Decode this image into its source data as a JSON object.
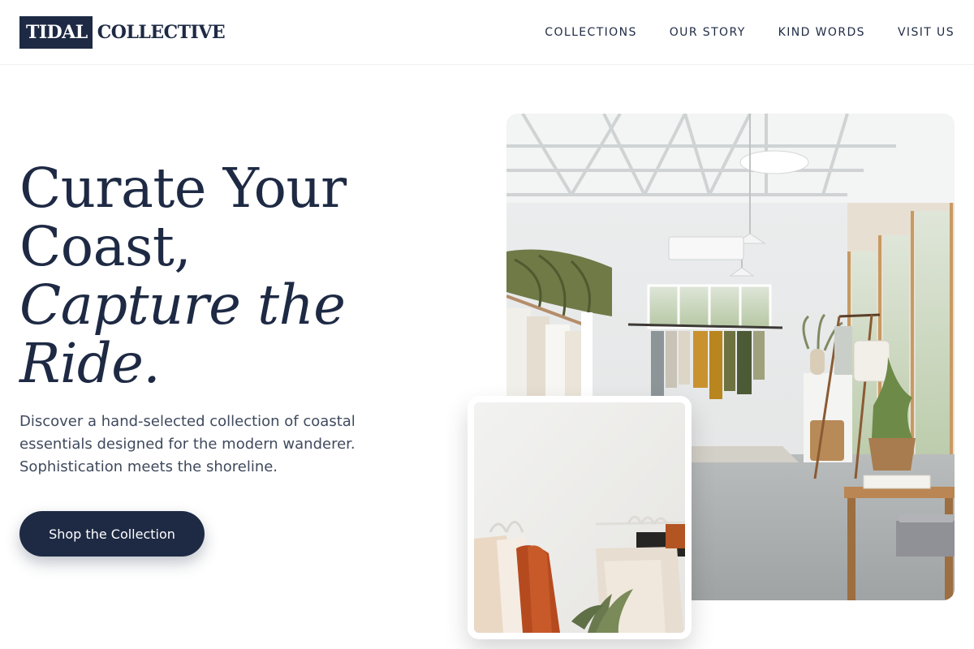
{
  "brand": {
    "box_text": "TIDAL",
    "text": "COLLECTIVE",
    "color": "#1e2a44"
  },
  "nav": {
    "items": [
      {
        "label": "COLLECTIONS"
      },
      {
        "label": "OUR STORY"
      },
      {
        "label": "KIND WORDS"
      },
      {
        "label": "VISIT US"
      }
    ]
  },
  "hero": {
    "title_line1": "Curate Your",
    "title_line2": "Coast,",
    "title_line3": "Capture the",
    "title_line4": "Ride.",
    "description_lines": [
      "Discover a hand-selected collection of coastal",
      "essentials designed for the modern wanderer.",
      "Sophistication meets the shoreline."
    ],
    "cta_label": "Shop the Collection"
  },
  "images": {
    "main_alt": "Bright boutique interior with clothing racks, plants and wooden table",
    "inset_alt": "Clothing rack with neutral and rust-colored garments"
  },
  "colors": {
    "primary": "#1e2a44",
    "text_muted": "#3f4a5e",
    "background": "#ffffff"
  }
}
